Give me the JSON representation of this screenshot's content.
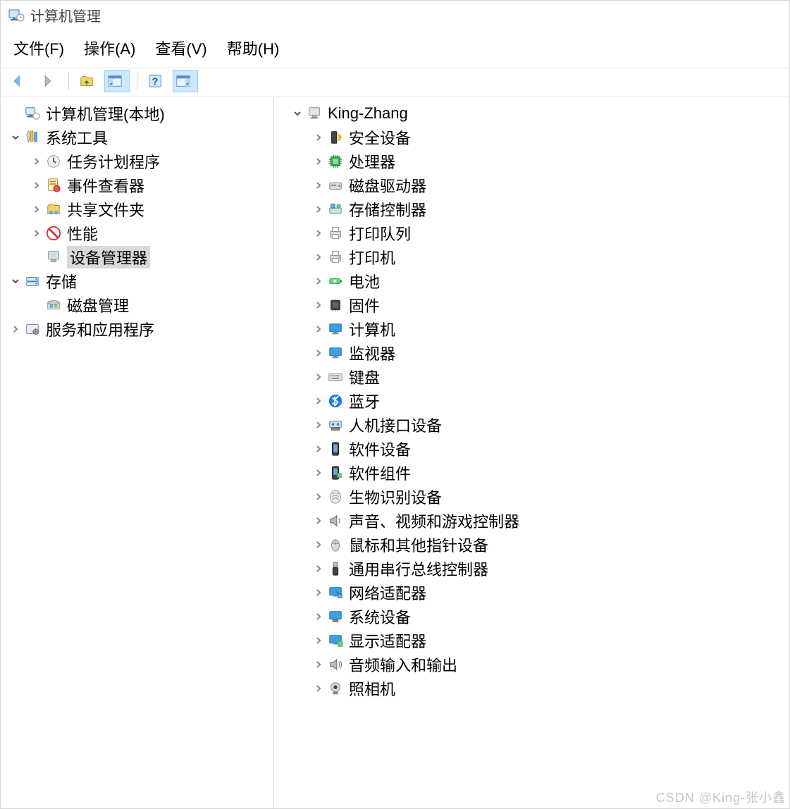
{
  "window": {
    "title": "计算机管理",
    "icon": "computer-management-icon"
  },
  "menubar": [
    {
      "label": "文件(F)"
    },
    {
      "label": "操作(A)"
    },
    {
      "label": "查看(V)"
    },
    {
      "label": "帮助(H)"
    }
  ],
  "toolbar": [
    {
      "name": "back-button",
      "icon": "arrow-left-icon",
      "active": false
    },
    {
      "name": "forward-button",
      "icon": "arrow-right-icon",
      "active": false
    },
    {
      "sep": true
    },
    {
      "name": "up-button",
      "icon": "folder-up-icon",
      "active": false
    },
    {
      "name": "show-hide-tree-button",
      "icon": "panel-icon",
      "active": true
    },
    {
      "sep": true
    },
    {
      "name": "help-button",
      "icon": "help-icon",
      "active": false
    },
    {
      "name": "show-hide-actions-button",
      "icon": "panel2-icon",
      "active": true
    }
  ],
  "left_tree": [
    {
      "indent": 0,
      "label": "计算机管理(本地)",
      "icon": "computer-management-icon",
      "state": "leaf",
      "name": "node-computer-management-local"
    },
    {
      "indent": 0,
      "label": "系统工具",
      "icon": "system-tools-icon",
      "state": "expanded",
      "name": "node-system-tools"
    },
    {
      "indent": 1,
      "label": "任务计划程序",
      "icon": "task-scheduler-icon",
      "state": "collapsed",
      "name": "node-task-scheduler"
    },
    {
      "indent": 1,
      "label": "事件查看器",
      "icon": "event-viewer-icon",
      "state": "collapsed",
      "name": "node-event-viewer"
    },
    {
      "indent": 1,
      "label": "共享文件夹",
      "icon": "shared-folders-icon",
      "state": "collapsed",
      "name": "node-shared-folders"
    },
    {
      "indent": 1,
      "label": "性能",
      "icon": "performance-icon",
      "state": "collapsed",
      "name": "node-performance"
    },
    {
      "indent": 1,
      "label": "设备管理器",
      "icon": "device-manager-icon",
      "state": "leaf",
      "name": "node-device-manager",
      "selected": true
    },
    {
      "indent": 0,
      "label": "存储",
      "icon": "storage-icon",
      "state": "expanded",
      "name": "node-storage"
    },
    {
      "indent": 1,
      "label": "磁盘管理",
      "icon": "disk-management-icon",
      "state": "leaf",
      "name": "node-disk-management"
    },
    {
      "indent": 0,
      "label": "服务和应用程序",
      "icon": "services-apps-icon",
      "state": "collapsed",
      "name": "node-services-apps"
    }
  ],
  "right_tree": [
    {
      "indent": 0,
      "label": "King-Zhang",
      "icon": "computer-icon",
      "state": "expanded",
      "name": "node-root-computer"
    },
    {
      "indent": 1,
      "label": "安全设备",
      "icon": "security-device-icon",
      "state": "collapsed",
      "name": "node-security-devices"
    },
    {
      "indent": 1,
      "label": "处理器",
      "icon": "processor-icon",
      "state": "collapsed",
      "name": "node-processors"
    },
    {
      "indent": 1,
      "label": "磁盘驱动器",
      "icon": "disk-drive-icon",
      "state": "collapsed",
      "name": "node-disk-drives"
    },
    {
      "indent": 1,
      "label": "存储控制器",
      "icon": "storage-controller-icon",
      "state": "collapsed",
      "name": "node-storage-controllers"
    },
    {
      "indent": 1,
      "label": "打印队列",
      "icon": "print-queue-icon",
      "state": "collapsed",
      "name": "node-print-queues"
    },
    {
      "indent": 1,
      "label": "打印机",
      "icon": "printer-icon",
      "state": "collapsed",
      "name": "node-printers"
    },
    {
      "indent": 1,
      "label": "电池",
      "icon": "battery-icon",
      "state": "collapsed",
      "name": "node-batteries"
    },
    {
      "indent": 1,
      "label": "固件",
      "icon": "firmware-icon",
      "state": "collapsed",
      "name": "node-firmware"
    },
    {
      "indent": 1,
      "label": "计算机",
      "icon": "monitor-icon",
      "state": "collapsed",
      "name": "node-computer"
    },
    {
      "indent": 1,
      "label": "监视器",
      "icon": "monitor-icon",
      "state": "collapsed",
      "name": "node-monitors"
    },
    {
      "indent": 1,
      "label": "键盘",
      "icon": "keyboard-icon",
      "state": "collapsed",
      "name": "node-keyboards"
    },
    {
      "indent": 1,
      "label": "蓝牙",
      "icon": "bluetooth-icon",
      "state": "collapsed",
      "name": "node-bluetooth"
    },
    {
      "indent": 1,
      "label": "人机接口设备",
      "icon": "hid-icon",
      "state": "collapsed",
      "name": "node-hid"
    },
    {
      "indent": 1,
      "label": "软件设备",
      "icon": "software-device-icon",
      "state": "collapsed",
      "name": "node-software-devices"
    },
    {
      "indent": 1,
      "label": "软件组件",
      "icon": "software-component-icon",
      "state": "collapsed",
      "name": "node-software-components"
    },
    {
      "indent": 1,
      "label": "生物识别设备",
      "icon": "biometric-icon",
      "state": "collapsed",
      "name": "node-biometric"
    },
    {
      "indent": 1,
      "label": "声音、视频和游戏控制器",
      "icon": "sound-icon",
      "state": "collapsed",
      "name": "node-sound-video-game"
    },
    {
      "indent": 1,
      "label": "鼠标和其他指针设备",
      "icon": "mouse-icon",
      "state": "collapsed",
      "name": "node-mice"
    },
    {
      "indent": 1,
      "label": "通用串行总线控制器",
      "icon": "usb-icon",
      "state": "collapsed",
      "name": "node-usb-controllers"
    },
    {
      "indent": 1,
      "label": "网络适配器",
      "icon": "network-adapter-icon",
      "state": "collapsed",
      "name": "node-network-adapters"
    },
    {
      "indent": 1,
      "label": "系统设备",
      "icon": "system-device-icon",
      "state": "collapsed",
      "name": "node-system-devices"
    },
    {
      "indent": 1,
      "label": "显示适配器",
      "icon": "display-adapter-icon",
      "state": "collapsed",
      "name": "node-display-adapters"
    },
    {
      "indent": 1,
      "label": "音频输入和输出",
      "icon": "audio-io-icon",
      "state": "collapsed",
      "name": "node-audio-io"
    },
    {
      "indent": 1,
      "label": "照相机",
      "icon": "camera-icon",
      "state": "collapsed",
      "name": "node-cameras"
    }
  ],
  "watermark": "CSDN @King-张小鑫"
}
